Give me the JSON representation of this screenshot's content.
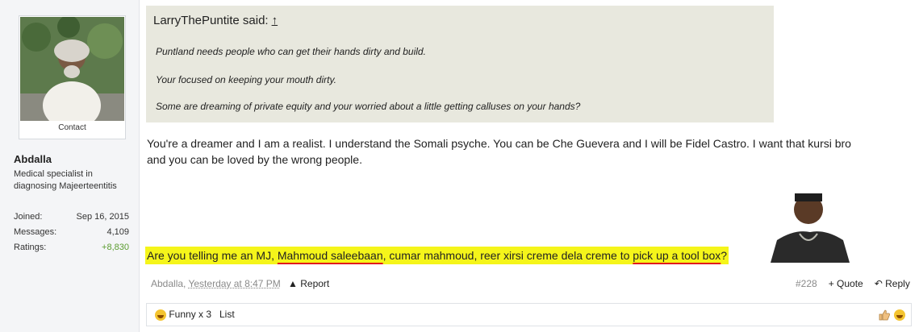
{
  "user": {
    "contact_label": "Contact",
    "name": "Abdalla",
    "title": "Medical specialist in diagnosing Majeerteentitis",
    "stats": [
      {
        "label": "Joined:",
        "value": "Sep 16, 2015"
      },
      {
        "label": "Messages:",
        "value": "4,109"
      },
      {
        "label": "Ratings:",
        "value": "+8,830"
      }
    ]
  },
  "quote": {
    "author_said": "LarryThePuntite said:",
    "jump_icon": "↑",
    "lines": [
      "Puntland needs people who can get their hands dirty and build.",
      "Your focused on keeping your mouth dirty.",
      "Some are dreaming of private equity and your worried about a little getting calluses on your hands?"
    ]
  },
  "message": {
    "line1": "You're a dreamer and I am a realist. I understand the Somali psyche. You can be Che Guevera and I will be Fidel Castro. I want that kursi bro",
    "line2": "and you can be loved by the wrong people.",
    "highlight": {
      "part1": "Are you telling me an MJ, ",
      "part2": "Mahmoud saleebaan",
      "part3": ", cumar mahmoud, reer xirsi creme dela creme to ",
      "part4": "pick up a tool box",
      "part5": "?"
    }
  },
  "footer": {
    "author": "Abdalla",
    "sep": ", ",
    "time": "Yesterday at 8:47 PM",
    "report": "Report",
    "post_number": "#228",
    "quote": "+ Quote",
    "reply": "Reply"
  },
  "ratings": {
    "funny_label": "Funny x 3",
    "list_label": "List"
  },
  "colors": {
    "highlight": "#f5f51a",
    "quote_bg": "#e8e8de",
    "positive": "#5b9c30",
    "underline": "#e21b1b"
  }
}
